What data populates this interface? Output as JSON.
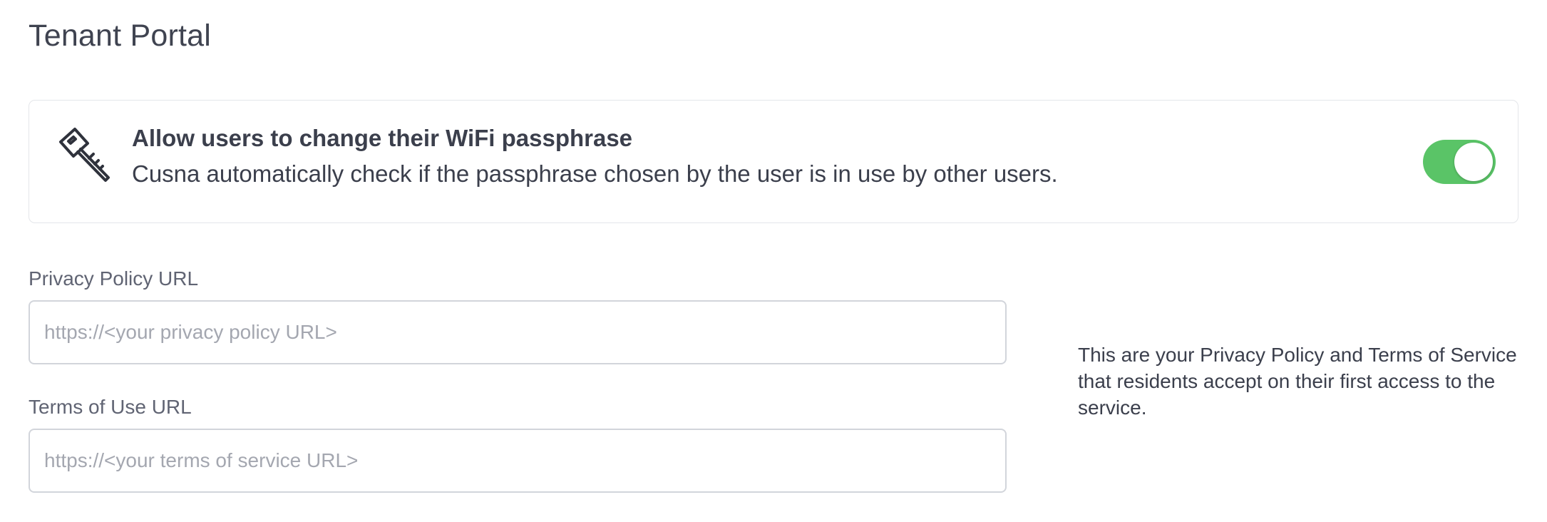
{
  "page": {
    "title": "Tenant Portal"
  },
  "passphrase_setting": {
    "icon": "key-icon",
    "title": "Allow users to change their WiFi passphrase",
    "description": "Cusna automatically check if the passphrase chosen by the user is in use by other users.",
    "enabled": true
  },
  "privacy_policy": {
    "label": "Privacy Policy URL",
    "value": "",
    "placeholder": "https://<your privacy policy URL>"
  },
  "terms_of_use": {
    "label": "Terms of Use URL",
    "value": "",
    "placeholder": "https://<your terms of service URL>"
  },
  "help": {
    "text": "This are your Privacy Policy and Terms of Service that residents accept on their first access to the service."
  },
  "colors": {
    "toggle_on": "#5ac467",
    "text": "#3b3f4c",
    "label": "#606473",
    "placeholder": "#a4a7b0",
    "border": "#d2d5db"
  }
}
